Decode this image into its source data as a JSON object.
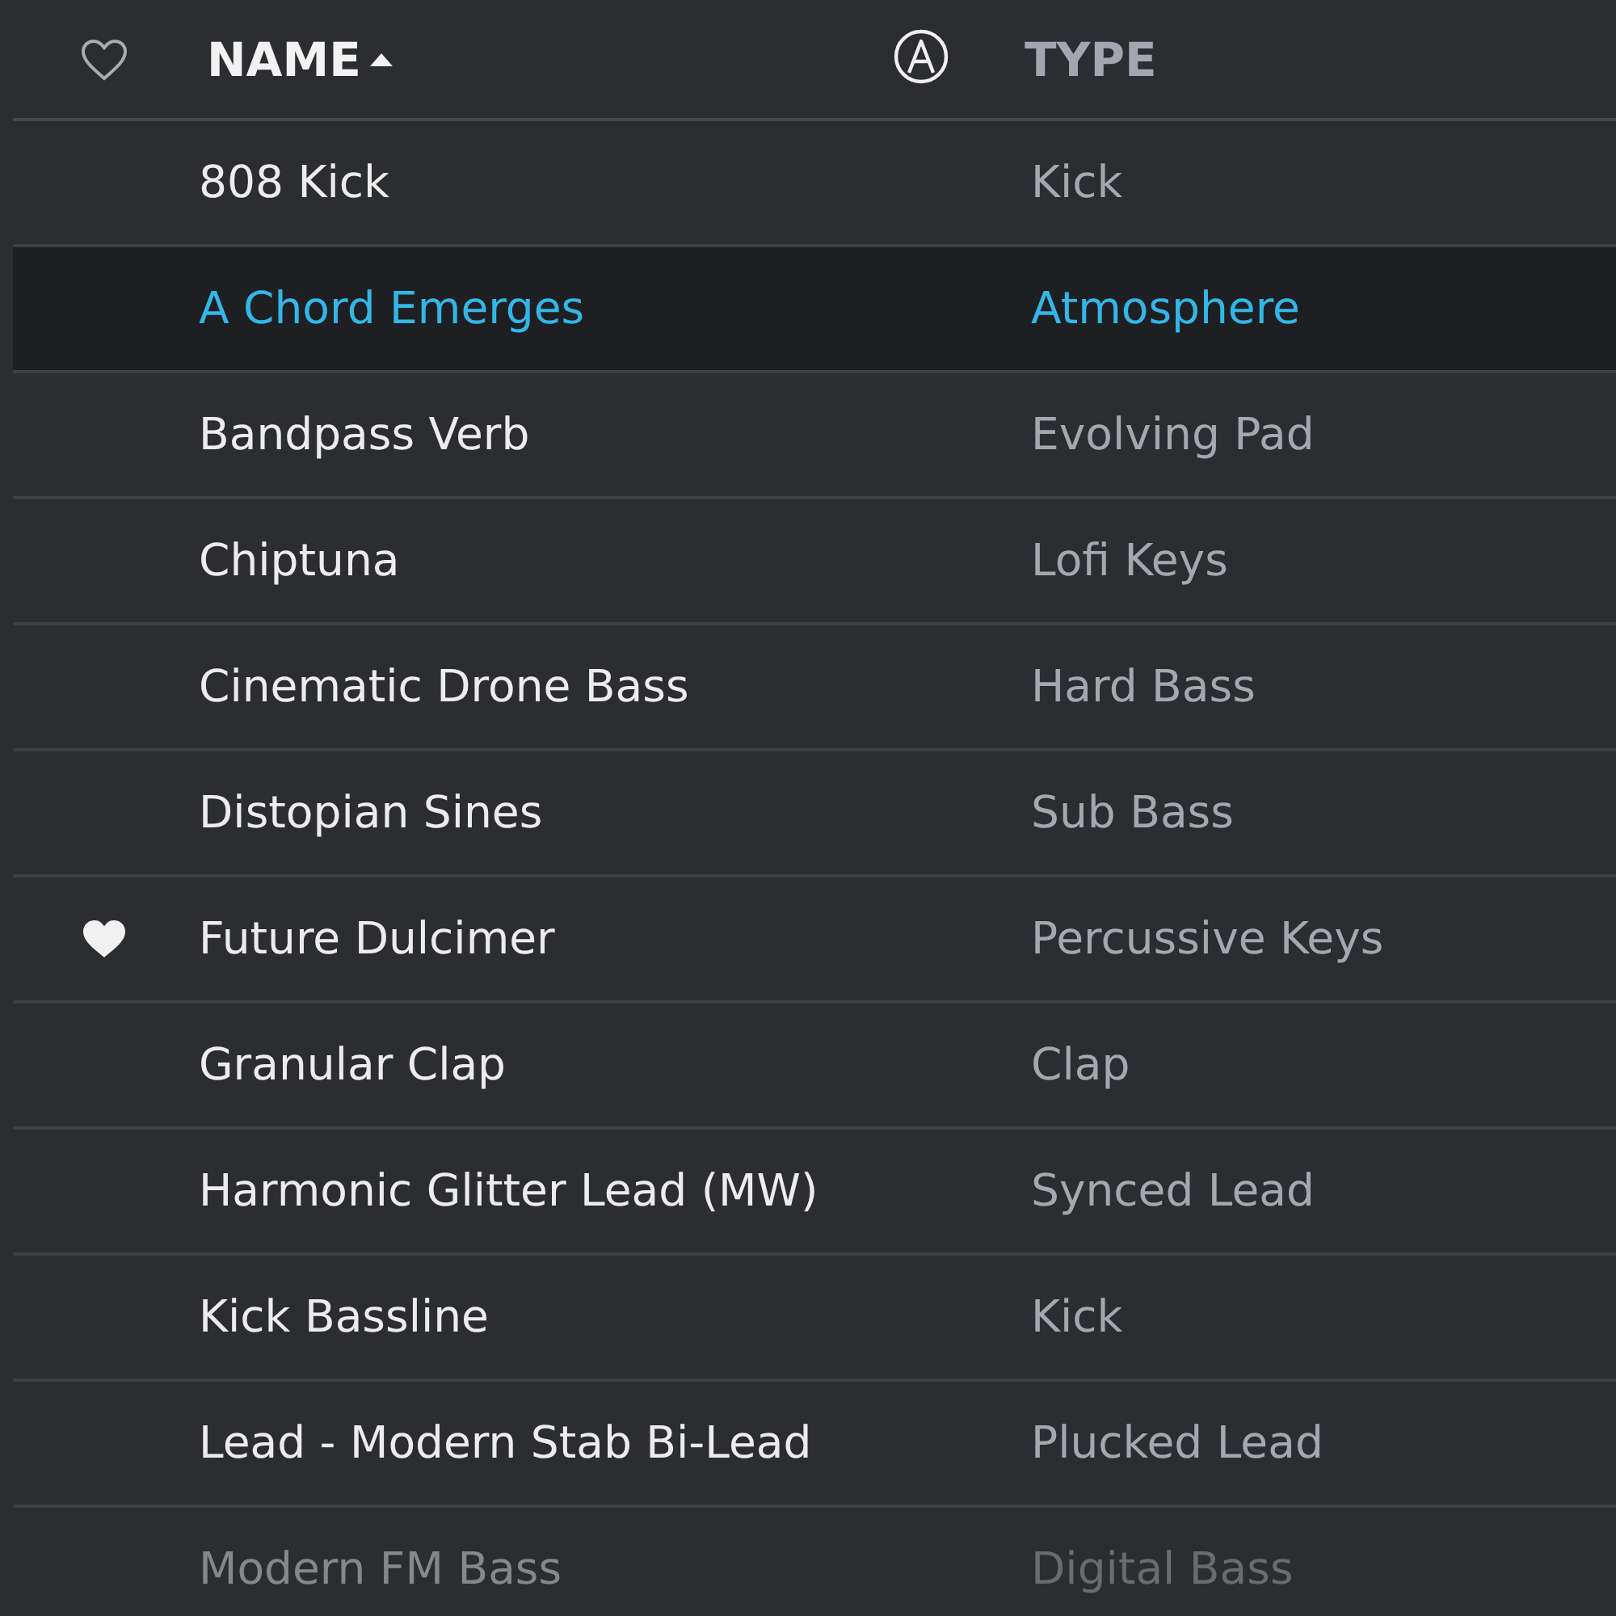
{
  "header": {
    "columns": [
      {
        "label": "NAME",
        "sorted": true
      },
      {
        "label": "TYPE",
        "sorted": false
      }
    ]
  },
  "rows": [
    {
      "name": "808 Kick",
      "type": "Kick",
      "favorite": false,
      "selected": false,
      "dimmed": false
    },
    {
      "name": "A Chord Emerges",
      "type": "Atmosphere",
      "favorite": false,
      "selected": true,
      "dimmed": false
    },
    {
      "name": "Bandpass Verb",
      "type": "Evolving Pad",
      "favorite": false,
      "selected": false,
      "dimmed": false
    },
    {
      "name": "Chiptuna",
      "type": "Lofi Keys",
      "favorite": false,
      "selected": false,
      "dimmed": false
    },
    {
      "name": "Cinematic Drone Bass",
      "type": "Hard Bass",
      "favorite": false,
      "selected": false,
      "dimmed": false
    },
    {
      "name": "Distopian Sines",
      "type": "Sub Bass",
      "favorite": false,
      "selected": false,
      "dimmed": false
    },
    {
      "name": "Future Dulcimer",
      "type": "Percussive Keys",
      "favorite": true,
      "selected": false,
      "dimmed": false
    },
    {
      "name": "Granular Clap",
      "type": "Clap",
      "favorite": false,
      "selected": false,
      "dimmed": false
    },
    {
      "name": "Harmonic Glitter Lead (MW)",
      "type": "Synced Lead",
      "favorite": false,
      "selected": false,
      "dimmed": false
    },
    {
      "name": "Kick Bassline",
      "type": "Kick",
      "favorite": false,
      "selected": false,
      "dimmed": false
    },
    {
      "name": "Lead - Modern Stab Bi-Lead",
      "type": "Plucked Lead",
      "favorite": false,
      "selected": false,
      "dimmed": false
    },
    {
      "name": "Modern FM Bass",
      "type": "Digital Bass",
      "favorite": false,
      "selected": false,
      "dimmed": true
    }
  ]
}
